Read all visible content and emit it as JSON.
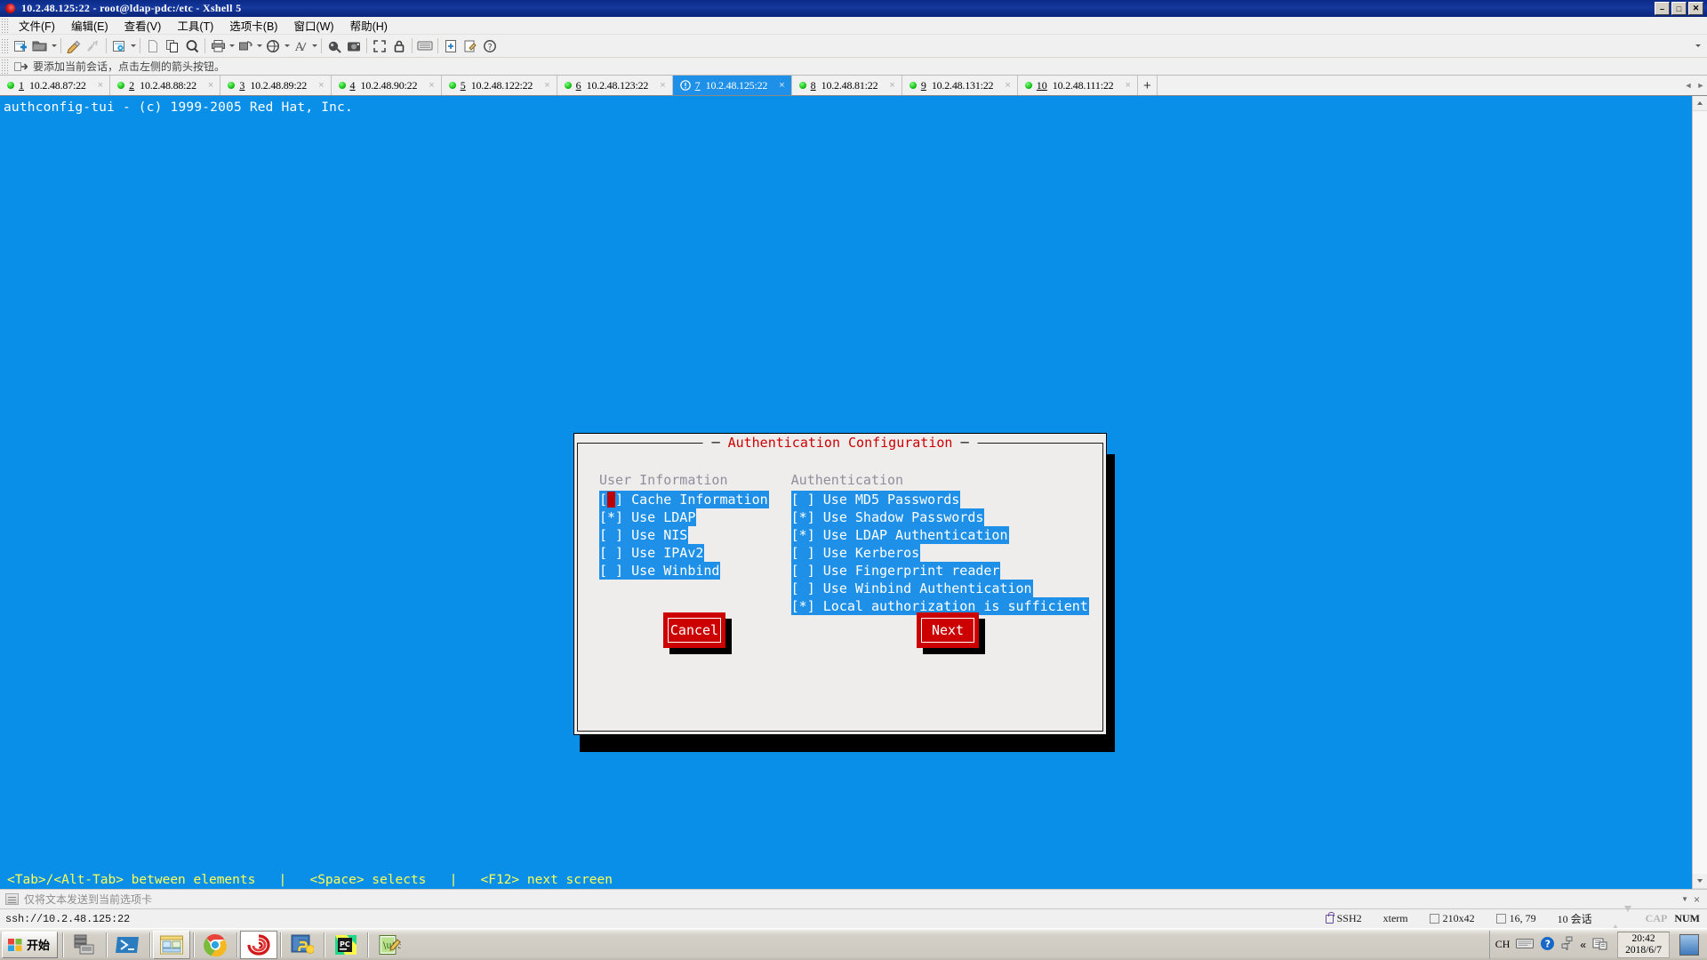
{
  "window": {
    "title": "10.2.48.125:22 - root@ldap-pdc:/etc - Xshell 5",
    "app_icon": "xshell-spiral-icon",
    "minimize_label": "–",
    "maximize_label": "□",
    "close_label": "✕"
  },
  "menubar": {
    "items": [
      {
        "label": "文件(F)",
        "name": "menu-file"
      },
      {
        "label": "编辑(E)",
        "name": "menu-edit"
      },
      {
        "label": "查看(V)",
        "name": "menu-view"
      },
      {
        "label": "工具(T)",
        "name": "menu-tools"
      },
      {
        "label": "选项卡(B)",
        "name": "menu-tabs"
      },
      {
        "label": "窗口(W)",
        "name": "menu-window"
      },
      {
        "label": "帮助(H)",
        "name": "menu-help"
      }
    ]
  },
  "toolbar": {
    "icons": [
      "new-session-icon",
      "open-folder-icon",
      "properties-icon",
      "disconnect-icon",
      "session-settings-icon",
      "new-file-icon",
      "copy-icon",
      "find-icon",
      "print-icon",
      "transfer-icon",
      "sftp-icon",
      "font-icon",
      "highlight-icon",
      "screenshot-icon",
      "fullscreen-icon",
      "lock-icon",
      "keyboard-icon",
      "add-note-icon",
      "compose-icon",
      "help-icon"
    ],
    "overflow_label": "»"
  },
  "session_hint": {
    "icon": "add-session-arrow-icon",
    "text": "要添加当前会话，点击左侧的箭头按钮。"
  },
  "tabs": {
    "items": [
      {
        "num": "1",
        "label": "10.2.48.87:22",
        "active": false,
        "status": "connected",
        "close": "×"
      },
      {
        "num": "2",
        "label": "10.2.48.88:22",
        "active": false,
        "status": "connected",
        "close": "×"
      },
      {
        "num": "3",
        "label": "10.2.48.89:22",
        "active": false,
        "status": "connected",
        "close": "×"
      },
      {
        "num": "4",
        "label": "10.2.48.90:22",
        "active": false,
        "status": "connected",
        "close": "×"
      },
      {
        "num": "5",
        "label": "10.2.48.122:22",
        "active": false,
        "status": "connected",
        "close": "×"
      },
      {
        "num": "6",
        "label": "10.2.48.123:22",
        "active": false,
        "status": "connected",
        "close": "×"
      },
      {
        "num": "7",
        "label": "10.2.48.125:22",
        "active": true,
        "status": "alert",
        "close": "×"
      },
      {
        "num": "8",
        "label": "10.2.48.81:22",
        "active": false,
        "status": "connected",
        "close": "×"
      },
      {
        "num": "9",
        "label": "10.2.48.131:22",
        "active": false,
        "status": "connected",
        "close": "×"
      },
      {
        "num": "10",
        "label": "10.2.48.111:22",
        "active": false,
        "status": "connected",
        "close": "×"
      }
    ],
    "new_tab_label": "+",
    "scroll_left": "◄",
    "scroll_right": "►"
  },
  "terminal": {
    "header_line": "authconfig-tui - (c) 1999-2005 Red Hat, Inc.",
    "background_color": "#0a8fe8",
    "help_bar": "<Tab>/<Alt-Tab> between elements   |   <Space> selects   |   <F12> next screen"
  },
  "dialog": {
    "title": "Authentication Configuration",
    "title_color": "#cc0000",
    "columns": [
      {
        "heading": "User Information",
        "items": [
          {
            "mark": "[ ]",
            "label": "Cache Information",
            "cursor": true
          },
          {
            "mark": "[*]",
            "label": "Use LDAP",
            "cursor": false
          },
          {
            "mark": "[ ]",
            "label": "Use NIS",
            "cursor": false
          },
          {
            "mark": "[ ]",
            "label": "Use IPAv2",
            "cursor": false
          },
          {
            "mark": "[ ]",
            "label": "Use Winbind",
            "cursor": false
          }
        ]
      },
      {
        "heading": "Authentication",
        "items": [
          {
            "mark": "[ ]",
            "label": "Use MD5 Passwords",
            "cursor": false
          },
          {
            "mark": "[*]",
            "label": "Use Shadow Passwords",
            "cursor": false
          },
          {
            "mark": "[*]",
            "label": "Use LDAP Authentication",
            "cursor": false
          },
          {
            "mark": "[ ]",
            "label": "Use Kerberos",
            "cursor": false
          },
          {
            "mark": "[ ]",
            "label": "Use Fingerprint reader",
            "cursor": false
          },
          {
            "mark": "[ ]",
            "label": "Use Winbind Authentication",
            "cursor": false
          },
          {
            "mark": "[*]",
            "label": "Local authorization is sufficient",
            "cursor": false
          }
        ]
      }
    ],
    "buttons": {
      "cancel": "Cancel",
      "next": "Next"
    },
    "colors": {
      "panel": "#efecec",
      "highlight": "#1e90e8",
      "button": "#cc0000",
      "cursor": "#c00000"
    }
  },
  "send_bar": {
    "icon": "send-to-tab-icon",
    "text": "仅将文本发送到当前选项卡",
    "caret": "▼",
    "close": "×"
  },
  "status_bar": {
    "url": "ssh://10.2.48.125:22",
    "protocol": "SSH2",
    "term_type": "xterm",
    "size": "210x42",
    "cursor": "16, 79",
    "sessions": "10 会话",
    "cap": "CAP",
    "num": "NUM",
    "size_icon": "window-size-icon",
    "cursor_icon": "cursor-position-icon",
    "lock_icon": "lock-icon"
  },
  "taskbar": {
    "start_label": "开始",
    "apps": [
      {
        "name": "server-manager-icon",
        "active": false
      },
      {
        "name": "powershell-icon",
        "active": false
      },
      {
        "name": "file-explorer-icon",
        "active": false
      },
      {
        "name": "chrome-icon",
        "active": false
      },
      {
        "name": "xshell-icon",
        "active": true
      },
      {
        "name": "python-icon",
        "active": false
      },
      {
        "name": "pycharm-icon",
        "active": false
      },
      {
        "name": "notepadpp-icon",
        "active": false
      }
    ],
    "tray": {
      "language": "CH",
      "keyboard_icon": "keyboard-icon",
      "help_icon": "help-icon",
      "network_icon": "network-icon",
      "show_hidden": "«",
      "action_center_icon": "action-center-icon",
      "time": "20:42",
      "date": "2018/6/7",
      "show_desktop": "show-desktop-button"
    }
  }
}
